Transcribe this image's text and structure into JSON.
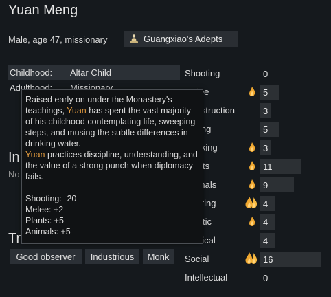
{
  "pawn": {
    "name": "Yuan Meng",
    "description": "Male, age 47, missionary",
    "faction": "Guangxiao's Adepts",
    "faction_icon": "meditating-figure-icon"
  },
  "backstory": {
    "childhood_label": "Childhood:",
    "childhood_value": "Altar Child",
    "adulthood_label": "Adulthood:",
    "adulthood_value": "Missionary"
  },
  "incapable": {
    "title_fragment": "In",
    "text_fragment": "No"
  },
  "traits": {
    "title": "Traits",
    "items": [
      "Good observer",
      "Industrious",
      "Monk"
    ]
  },
  "skills": [
    {
      "label": "Shooting",
      "level": 0,
      "passion": "none"
    },
    {
      "label": "Melee",
      "level": 5,
      "passion": "minor"
    },
    {
      "label": "Construction",
      "level": 3,
      "passion": "none"
    },
    {
      "label": "Mining",
      "level": 5,
      "passion": "none"
    },
    {
      "label": "Cooking",
      "level": 3,
      "passion": "minor"
    },
    {
      "label": "Plants",
      "level": 11,
      "passion": "minor"
    },
    {
      "label": "Animals",
      "level": 9,
      "passion": "minor"
    },
    {
      "label": "Crafting",
      "level": 4,
      "passion": "major"
    },
    {
      "label": "Artistic",
      "level": 4,
      "passion": "minor"
    },
    {
      "label": "Medical",
      "level": 4,
      "passion": "none"
    },
    {
      "label": "Social",
      "level": 16,
      "passion": "major"
    },
    {
      "label": "Intellectual",
      "level": 0,
      "passion": "none"
    }
  ],
  "tooltip": {
    "line1": "Raised early on under the Monastery's teachings, ",
    "name1": "Yuan",
    "line2": " has spent the vast majority of his childhood contemplating life, sweeping steps, and musing the subtle differences in drinking water.",
    "name2": "Yuan",
    "line3": " practices discipline, understanding, and the value of a strong punch when diplomacy fails.",
    "mods": [
      "Shooting: -20",
      "Melee: +2",
      "Plants: +5",
      "Animals: +5"
    ]
  },
  "colors": {
    "background": "#15191d",
    "panel": "#2b3036",
    "bar": "#2c3034",
    "pawn_name_highlight": "#e39b3f",
    "flame_outer": "#f0a830",
    "flame_inner": "#ffd27a"
  }
}
